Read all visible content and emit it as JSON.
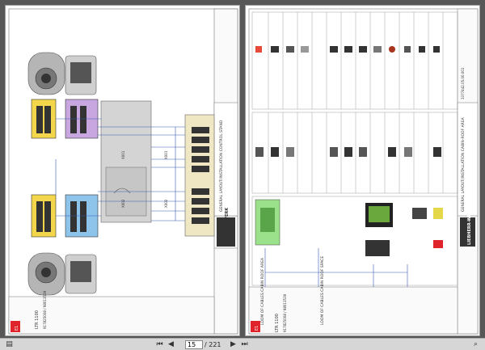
{
  "viewer": {
    "page_input": "15",
    "page_count": "/ 221",
    "first_label": "⏮",
    "prev_label": "◀",
    "next_label": "▶",
    "last_label": "⏭",
    "menu_label": "▤",
    "search_label": "⌕"
  },
  "left_page": {
    "model": "LTR 1100",
    "doc_numbers": "917825008 / 98013539",
    "section": "GENERAL LAYOUT/INSTALLATION CONTROL STAND",
    "brand": "LIEBHERR-WERK",
    "sheet": "E1",
    "wire_labels": [
      "X001",
      "X001",
      "X002",
      "X002"
    ]
  },
  "right_page": {
    "model": "LTR 1100",
    "doc_numbers": "917825008 / 98013539",
    "section": "GENERAL LAYOUT/INSTALLATION CABIN-ROOF AREA",
    "brand": "LIEBHERR-WERK",
    "sheet": "E1",
    "loom_label_1": "LOOM OF CABLES CABIN ROOF AREA",
    "loom_label_2": "LOOM OF CABLES CABIN ROOF SPACE",
    "code": "3377442.05.00.001"
  }
}
